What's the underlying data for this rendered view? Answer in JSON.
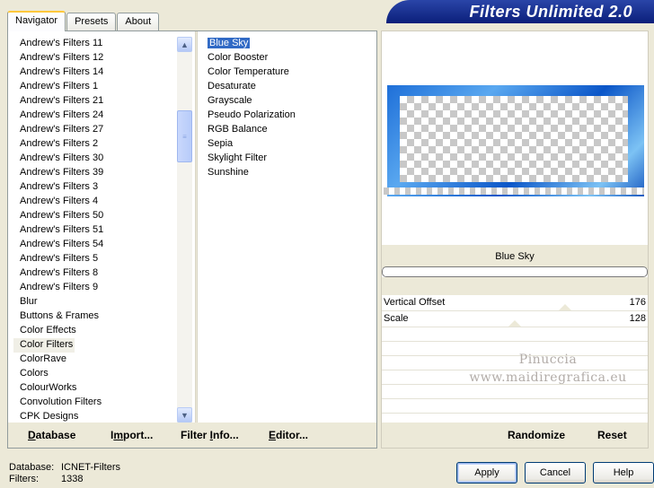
{
  "tabs": [
    {
      "label": "Navigator",
      "active": true
    },
    {
      "label": "Presets",
      "active": false
    },
    {
      "label": "About",
      "active": false
    }
  ],
  "banner": {
    "title": "Filters Unlimited 2.0"
  },
  "categories": {
    "items": [
      "Andrew's Filters 11",
      "Andrew's Filters 12",
      "Andrew's Filters 14",
      "Andrew's Filters 1",
      "Andrew's Filters 21",
      "Andrew's Filters 24",
      "Andrew's Filters 27",
      "Andrew's Filters 2",
      "Andrew's Filters 30",
      "Andrew's Filters 39",
      "Andrew's Filters 3",
      "Andrew's Filters 4",
      "Andrew's Filters 50",
      "Andrew's Filters 51",
      "Andrew's Filters 54",
      "Andrew's Filters 5",
      "Andrew's Filters 8",
      "Andrew's Filters 9",
      "Blur",
      "Buttons & Frames",
      "Color Effects",
      "Color Filters",
      "ColorRave",
      "Colors",
      "ColourWorks",
      "Convolution Filters",
      "CPK Designs"
    ],
    "selected": "Color Filters"
  },
  "filters": {
    "items": [
      "Blue Sky",
      "Color Booster",
      "Color Temperature",
      "Desaturate",
      "Grayscale",
      "Pseudo Polarization",
      "RGB Balance",
      "Sepia",
      "Skylight Filter",
      "Sunshine"
    ],
    "selected": "Blue Sky"
  },
  "panel_buttons": {
    "database": {
      "first": "D",
      "rest": "atabase"
    },
    "import": {
      "pre": "I",
      "u": "m",
      "post": "port..."
    },
    "filter_info": {
      "pre": "Filter ",
      "u": "I",
      "post": "nfo..."
    },
    "editor": {
      "first": "E",
      "rest": "ditor..."
    }
  },
  "preview": {
    "filter_name": "Blue Sky"
  },
  "params": [
    {
      "label": "Vertical Offset",
      "value": "176",
      "level": 0.69
    },
    {
      "label": "Scale",
      "value": "128",
      "level": 0.5
    }
  ],
  "watermark": {
    "line1": "Pinuccia",
    "line2": "www.maidiregrafica.eu"
  },
  "right_buttons": {
    "randomize": "Randomize",
    "reset": "Reset"
  },
  "status": {
    "database_label": "Database:",
    "database_value": "ICNET-Filters",
    "filters_label": "Filters:",
    "filters_value": "1338"
  },
  "dialog_buttons": {
    "apply": "Apply",
    "cancel": "Cancel",
    "help": "Help"
  }
}
